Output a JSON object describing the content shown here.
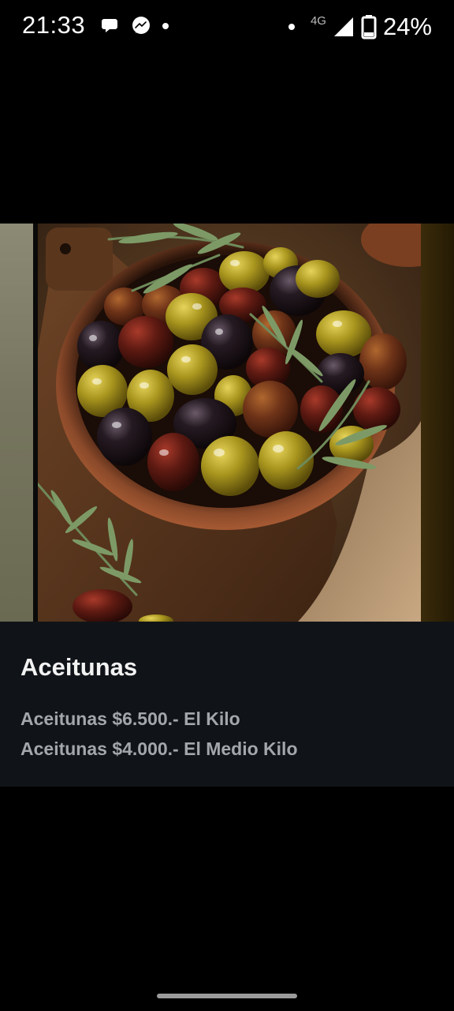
{
  "status_bar": {
    "time": "21:33",
    "network": "4G",
    "battery": "24%",
    "icons": [
      "chat-bubble-icon",
      "messenger-icon",
      "notification-dot-icon",
      "signal-icon",
      "battery-icon"
    ]
  },
  "product": {
    "title": "Aceitunas",
    "prices": [
      "Aceitunas $6.500.- El Kilo",
      "Aceitunas $4.000.- El Medio Kilo"
    ]
  }
}
